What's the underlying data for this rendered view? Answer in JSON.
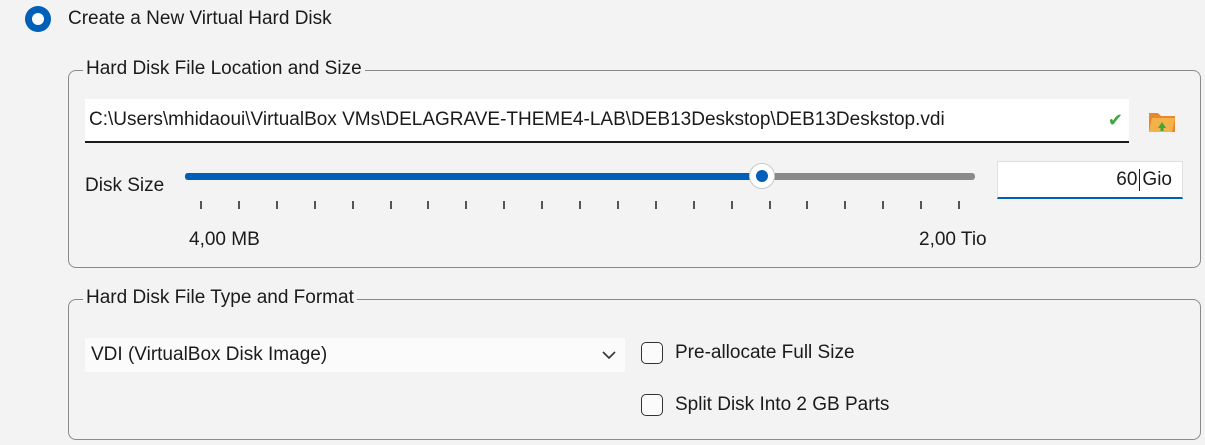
{
  "create_option": {
    "label": "Create a New Virtual Hard Disk",
    "selected": true
  },
  "location_group": {
    "title": "Hard Disk File Location and Size",
    "path_value": "C:\\Users\\mhidaoui\\VirtualBox VMs\\DELAGRAVE-THEME4-LAB\\DEB13Deskstop\\DEB13Deskstop.vdi",
    "path_valid_icon": "check-icon",
    "folder_icon": "folder-open-icon",
    "disk_size_label": "Disk Size",
    "slider": {
      "value_fraction": 0.73,
      "min_label": "4,00 MB",
      "max_label": "2,00 Tio",
      "tick_count": 21
    },
    "size_value": "60",
    "size_unit": "Gio"
  },
  "format_group": {
    "title": "Hard Disk File Type and Format",
    "format_selected": "VDI (VirtualBox Disk Image)",
    "preallocate_label": "Pre-allocate Full Size",
    "preallocate_checked": false,
    "split_label": "Split Disk Into 2 GB Parts",
    "split_checked": false
  },
  "colors": {
    "accent": "#005fb8",
    "check": "#3ca83c"
  }
}
